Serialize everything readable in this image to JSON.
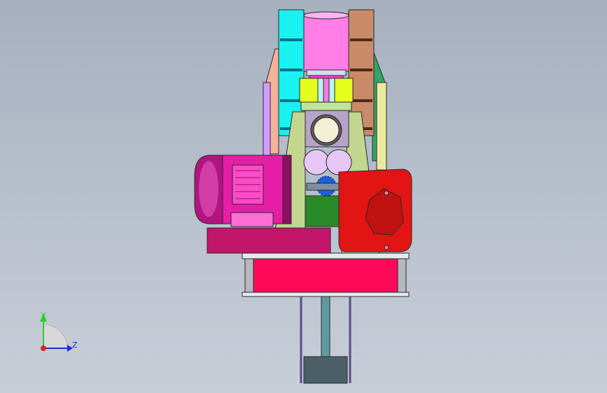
{
  "viewport": {
    "background_top": "#a6b0bf",
    "background_bottom": "#c8ced8"
  },
  "model": {
    "colors": {
      "cyan_panel": "#19f2f0",
      "brown_panel": "#c98a68",
      "cylinder": "#ff7fe6",
      "motor": "#e51ea8",
      "motor_dark": "#8c0f63",
      "frame_beam": "#ff0a5a",
      "plate": "#c2d68f",
      "gearbox": "#e21414",
      "gear": "#1b5fe0",
      "green_block": "#2a8a2a",
      "yellow_clamp": "#e4ff1e",
      "shaft": "#5e9aa4",
      "outline": "#2a2a2a"
    }
  },
  "triad": {
    "y_label": "Y",
    "z_label": "Z",
    "y_color": "#2ad02a",
    "z_color": "#1d2ee0",
    "x_color": "#e02020"
  }
}
